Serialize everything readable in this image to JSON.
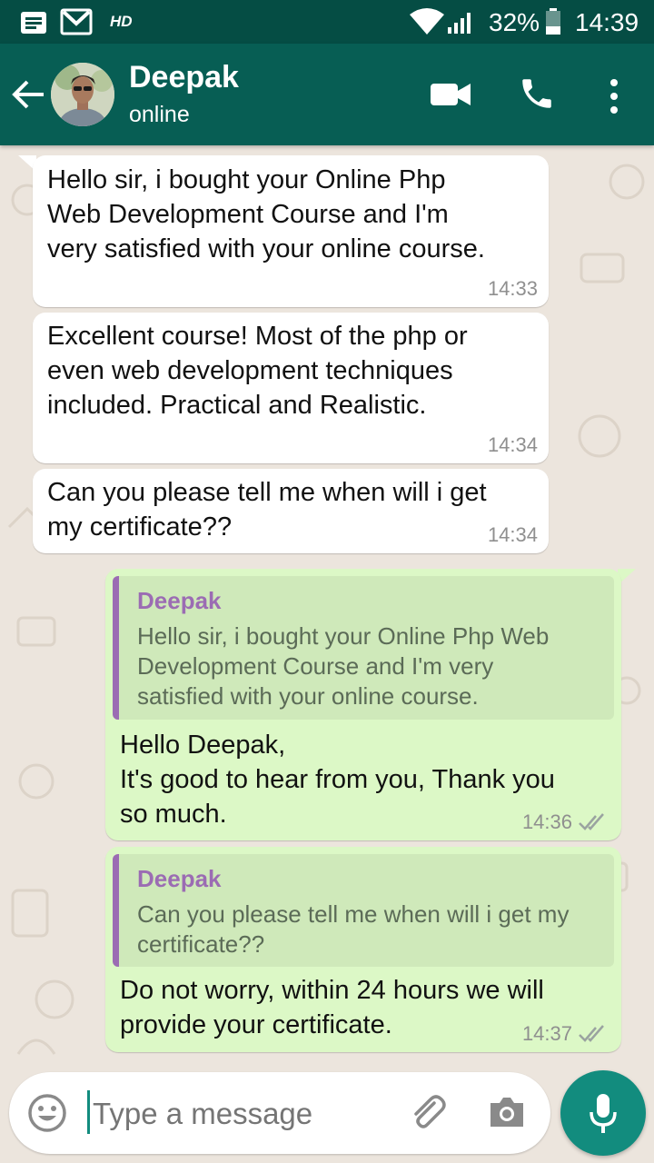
{
  "status_bar": {
    "network_label": "HD",
    "battery": "32%",
    "time": "14:39",
    "icons": [
      "notes-icon",
      "gmail-icon",
      "wifi-icon",
      "signal-icon",
      "battery-icon"
    ]
  },
  "header": {
    "contact_name": "Deepak",
    "status": "online"
  },
  "messages": [
    {
      "direction": "incoming",
      "text": "Hello sir, i bought your Online Php\nWeb Development Course and I'm\nvery satisfied with your online course.",
      "time": "14:33"
    },
    {
      "direction": "incoming",
      "text": "Excellent course! Most of the php or\neven web development techniques\nincluded. Practical and Realistic.",
      "time": "14:34"
    },
    {
      "direction": "incoming",
      "text": "Can you please tell me when will i get\nmy certificate??",
      "time": "14:34"
    },
    {
      "direction": "outgoing",
      "quote_author": "Deepak",
      "quote_text": "Hello sir, i bought your Online Php Web\nDevelopment Course and I'm very\nsatisfied with your online course.",
      "text": "Hello Deepak,\nIt's good to hear from you, Thank you\nso much.",
      "time": "14:36",
      "status_icon": "double-check-icon"
    },
    {
      "direction": "outgoing",
      "quote_author": "Deepak",
      "quote_text": "Can you please tell me when will i get my\ncertificate??",
      "text": "Do not worry, within 24 hours we will\nprovide your certificate.",
      "time": "14:37",
      "status_icon": "double-check-icon"
    }
  ],
  "composer": {
    "placeholder": "Type a message"
  },
  "colors": {
    "header": "#075E54",
    "status_bar": "#054D44",
    "chat_background": "#ECE5DD",
    "incoming_bubble": "#FFFFFF",
    "outgoing_bubble": "#DCF8C6",
    "quote_accent": "#9B6CB3",
    "fab": "#128C7E"
  }
}
